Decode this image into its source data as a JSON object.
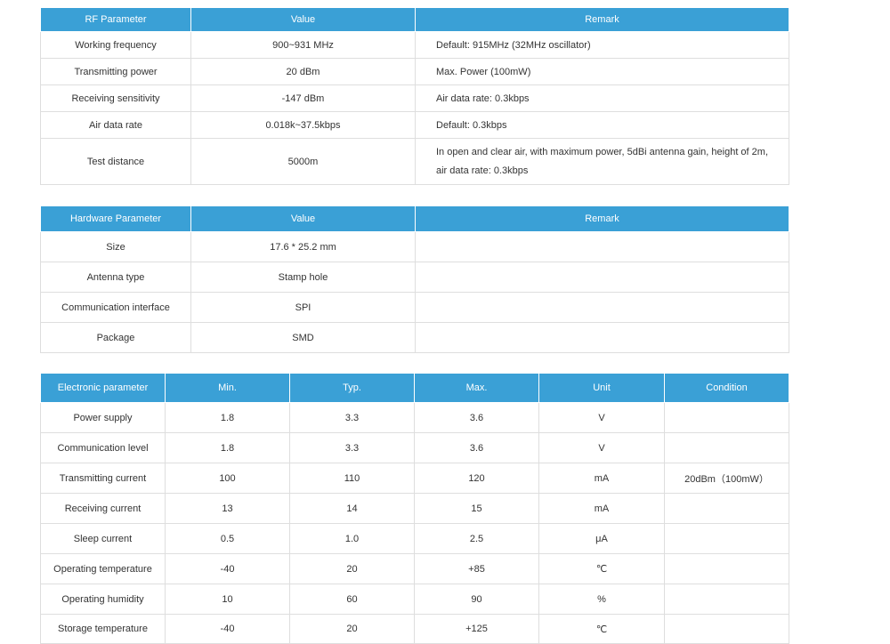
{
  "rf_table": {
    "headers": [
      "RF Parameter",
      "Value",
      "Remark"
    ],
    "rows": [
      {
        "param": "Working frequency",
        "value": "900~931 MHz",
        "remark": [
          "Default:  915MHz (32MHz oscillator)"
        ]
      },
      {
        "param": "Transmitting power",
        "value": "20 dBm",
        "remark": [
          "Max. Power (100mW)"
        ]
      },
      {
        "param": "Receiving sensitivity",
        "value": "-147 dBm",
        "remark": [
          "Air data rate: 0.3kbps"
        ]
      },
      {
        "param": "Air data rate",
        "value": "0.018k~37.5kbps",
        "remark": [
          "Default: 0.3kbps"
        ]
      },
      {
        "param": "Test distance",
        "value": "5000m",
        "remark": [
          "In open and clear air, with maximum power, 5dBi antenna gain, height of 2m,",
          "air data rate: 0.3kbps"
        ]
      }
    ]
  },
  "hw_table": {
    "headers": [
      "Hardware Parameter",
      "Value",
      "Remark"
    ],
    "rows": [
      {
        "param": "Size",
        "value": "17.6 * 25.2 mm",
        "remark": ""
      },
      {
        "param": "Antenna type",
        "value": "Stamp hole",
        "remark": ""
      },
      {
        "param": "Communication interface",
        "value": "SPI",
        "remark": ""
      },
      {
        "param": "Package",
        "value": "SMD",
        "remark": ""
      }
    ]
  },
  "el_table": {
    "headers": [
      "Electronic parameter",
      "Min.",
      "Typ.",
      "Max.",
      "Unit",
      "Condition"
    ],
    "rows": [
      [
        "Power supply",
        "1.8",
        "3.3",
        "3.6",
        "V",
        ""
      ],
      [
        "Communication level",
        "1.8",
        "3.3",
        "3.6",
        "V",
        ""
      ],
      [
        "Transmitting current",
        "100",
        "110",
        "120",
        "mA",
        "20dBm（100mW）"
      ],
      [
        "Receiving current",
        "13",
        "14",
        "15",
        "mA",
        ""
      ],
      [
        "Sleep current",
        "0.5",
        "1.0",
        "2.5",
        "μA",
        ""
      ],
      [
        "Operating temperature",
        "-40",
        "20",
        "+85",
        "℃",
        ""
      ],
      [
        "Operating humidity",
        "10",
        "60",
        "90",
        "%",
        ""
      ],
      [
        "Storage temperature",
        "-40",
        "20",
        "+125",
        "℃",
        ""
      ]
    ]
  }
}
